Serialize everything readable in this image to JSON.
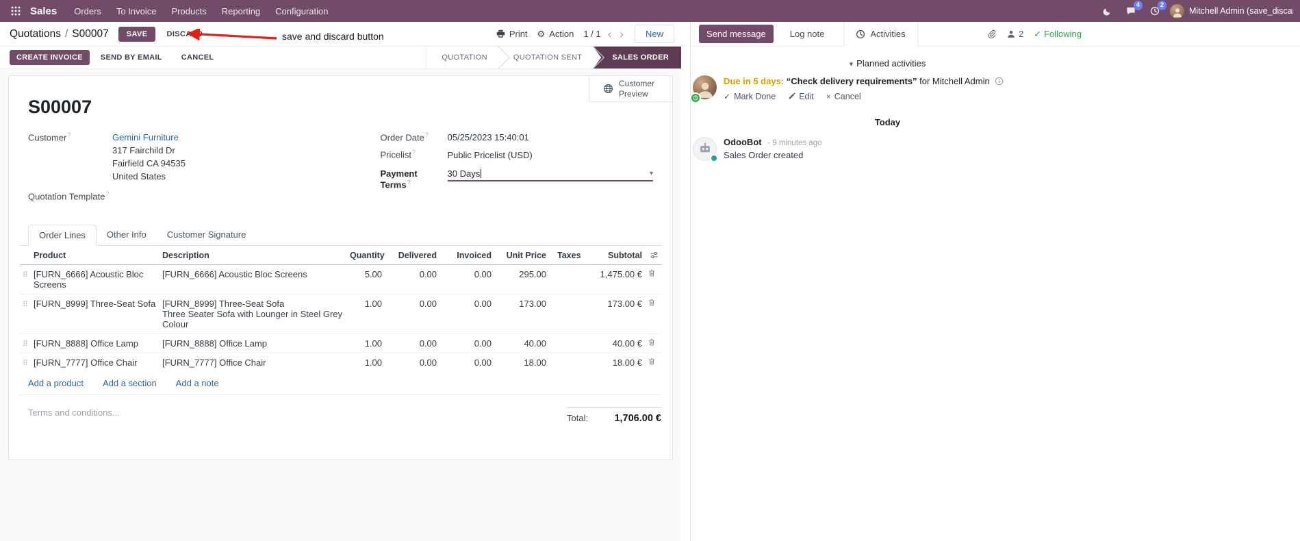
{
  "colors": {
    "brand": "#714B67",
    "stage_active": "#5d3b53",
    "edited_value": "#2160c4",
    "due_warning": "#d69e00",
    "following_green": "#28a745"
  },
  "icons": {
    "caret_down": "▾",
    "chevron_left": "‹",
    "chevron_right": "›",
    "help": "?",
    "drag_handle": "⠿",
    "check": "✓",
    "close": "×",
    "collapse_caret": "▾",
    "separator": "/"
  },
  "topbar": {
    "app_name": "Sales",
    "menus": [
      {
        "label": "Orders"
      },
      {
        "label": "To Invoice"
      },
      {
        "label": "Products"
      },
      {
        "label": "Reporting"
      },
      {
        "label": "Configuration"
      }
    ],
    "message_badge": "4",
    "activity_badge": "2",
    "user_name": "Mitchell Admin (save_discar"
  },
  "breadcrumb": {
    "section": "Quotations",
    "record": "S00007",
    "save_label": "SAVE",
    "discard_label": "DISCARD"
  },
  "annotation": {
    "text": "save and discard button"
  },
  "control": {
    "print_label": "Print",
    "action_label": "Action",
    "pager": "1 / 1",
    "new_label": "New"
  },
  "statusbar": {
    "create_invoice": "CREATE INVOICE",
    "send_by_email": "SEND BY EMAIL",
    "cancel": "CANCEL",
    "stages": [
      {
        "label": "QUOTATION"
      },
      {
        "label": "QUOTATION SENT"
      },
      {
        "label": "SALES ORDER"
      }
    ]
  },
  "form": {
    "preview_button": "Customer Preview",
    "title": "S00007",
    "customer_label": "Customer",
    "customer_name": "Gemini Furniture",
    "address_line1": "317 Fairchild Dr",
    "address_line2": "Fairfield CA 94535",
    "address_line3": "United States",
    "quotation_template_label": "Quotation Template",
    "order_date_label": "Order Date",
    "order_date_value": "05/25/2023 15:40:01",
    "pricelist_label": "Pricelist",
    "pricelist_value": "Public Pricelist (USD)",
    "payment_terms_label": "Payment Terms",
    "payment_terms_value": "30 Days",
    "tabs": [
      {
        "label": "Order Lines"
      },
      {
        "label": "Other Info"
      },
      {
        "label": "Customer Signature"
      }
    ],
    "table": {
      "headers": [
        "Product",
        "Description",
        "Quantity",
        "Delivered",
        "Invoiced",
        "Unit Price",
        "Taxes",
        "Subtotal"
      ],
      "rows": [
        {
          "product": "[FURN_6666] Acoustic Bloc Screens",
          "desc": "[FURN_6666] Acoustic Bloc Screens",
          "desc2": "",
          "qty": "5.00",
          "delivered": "0.00",
          "invoiced": "0.00",
          "price": "295.00",
          "taxes": "",
          "subtotal": "1,475.00 €"
        },
        {
          "product": "[FURN_8999] Three-Seat Sofa",
          "desc": "[FURN_8999] Three-Seat Sofa",
          "desc2": "Three Seater Sofa with Lounger in Steel Grey Colour",
          "qty": "1.00",
          "delivered": "0.00",
          "invoiced": "0.00",
          "price": "173.00",
          "taxes": "",
          "subtotal": "173.00 €"
        },
        {
          "product": "[FURN_8888] Office Lamp",
          "desc": "[FURN_8888] Office Lamp",
          "desc2": "",
          "qty": "1.00",
          "delivered": "0.00",
          "invoiced": "0.00",
          "price": "40.00",
          "taxes": "",
          "subtotal": "40.00 €"
        },
        {
          "product": "[FURN_7777] Office Chair",
          "desc": "[FURN_7777] Office Chair",
          "desc2": "",
          "qty": "1.00",
          "delivered": "0.00",
          "invoiced": "0.00",
          "price": "18.00",
          "taxes": "",
          "subtotal": "18.00 €"
        }
      ],
      "add_product": "Add a product",
      "add_section": "Add a section",
      "add_note": "Add a note"
    },
    "terms_placeholder": "Terms and conditions...",
    "total_label": "Total:",
    "total_value": "1,706.00 €"
  },
  "chatter": {
    "send_message": "Send message",
    "log_note": "Log note",
    "activities_tab": "Activities",
    "followers_count": "2",
    "following_label": "Following",
    "planned_header": "Planned activities",
    "activity": {
      "due": "Due in 5 days:",
      "summary": "“Check delivery requirements”",
      "assignee": "for Mitchell Admin",
      "mark_done": "Mark Done",
      "edit": "Edit",
      "cancel": "Cancel"
    },
    "day_divider": "Today",
    "message": {
      "author": "OdooBot",
      "time": "- 9 minutes ago",
      "body": "Sales Order created"
    }
  }
}
